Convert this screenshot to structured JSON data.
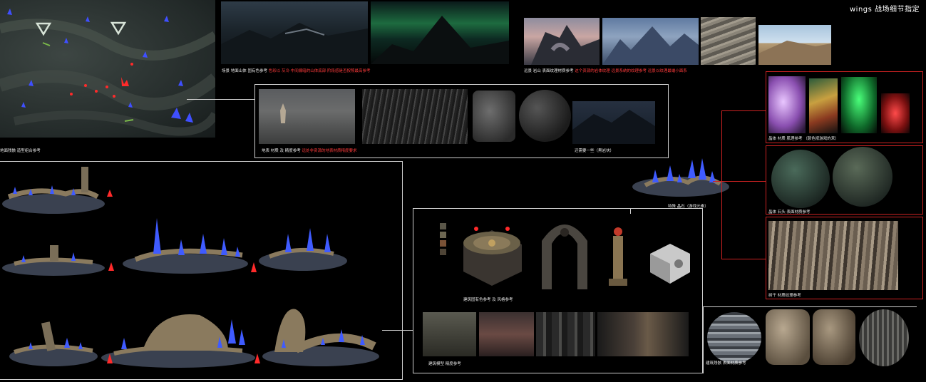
{
  "page": {
    "title": "wings 战场细节指定"
  },
  "captions": {
    "map": "地面残骸 造型组合参考",
    "scene_main": "场景 地面山体 固有色参考",
    "scene_note": "色彩以 灰冷·中间偏暗的山体底部·阶段感是否按照最高参考",
    "rock_main": "远景 岩山 表面纹理材质参考",
    "rock_note": "这个资源的岩体纹理 远景系统的纹理参考 远景以纹理最端小面系",
    "ground_main": "地表 材质 及 精度参考",
    "ground_note": "远处非资源的地表材质精度要求",
    "ground_right": "还需要一些（黑岩块）",
    "special": "特殊 晶石（游戏元素）",
    "crystal": "晶体 材质 肌理参考 （颜色按游戏的来）",
    "stone": "晶体 石头 表面材质参考",
    "tree": "树干 材质纹理参考",
    "building_color": "建筑固有色参考 及 风格参考",
    "building_model": "建筑模型 精度参考",
    "building_surface": "建筑残骸 表面材质参考"
  },
  "palette": {
    "accent_red": "#ff2a2a",
    "crystal_blue": "#3f5bff",
    "ruin_brown": "#8a7a5e",
    "base_slate": "#3a4150",
    "swatches": [
      "#5a5648",
      "#6d6752",
      "#7a5236",
      "#4e4436"
    ]
  }
}
